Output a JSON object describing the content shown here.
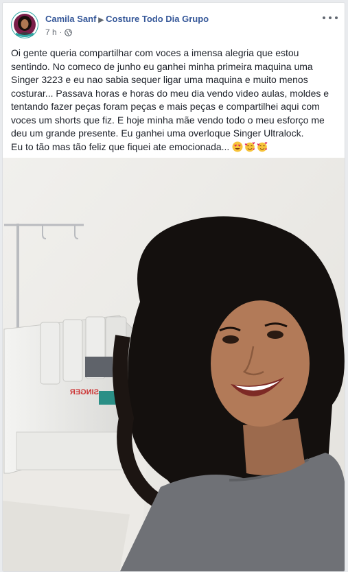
{
  "post": {
    "author": "Camila Sanf",
    "group": "Costure Todo Dia Grupo",
    "time": "7 h",
    "separator": "·",
    "privacy_icon": "globe-icon",
    "options_icon": "more-icon",
    "text_lines": [
      "Oi gente queria compartilhar com voces a imensa alegria que estou",
      "sentindo. No comeco de junho eu ganhei minha primeira maquina uma",
      "Singer 3223 e eu nao sabia sequer ligar uma maquina e muito menos",
      "costurar... Passava horas e horas do meu dia vendo video aulas, moldes e",
      "tentando fazer peças foram peças e mais peças e compartilhei aqui com",
      "voces um shorts que fiz. E hoje minha mãe vendo todo o meu esforço me",
      "deu um grande presente. Eu ganhei uma overloque Singer Ultralock."
    ],
    "last_line": "Eu to tão mas tão feliz que fiquei ate emocionada...",
    "emojis": [
      "heart-eyes-emoji",
      "smiling-hearts-emoji",
      "smiling-hearts-emoji"
    ]
  },
  "photo": {
    "machine_brand": "SINGER",
    "machine_brand_mirrored": true
  },
  "colors": {
    "link": "#365899",
    "text": "#1d2129",
    "meta": "#606770",
    "page_bg": "#e9ebee"
  }
}
